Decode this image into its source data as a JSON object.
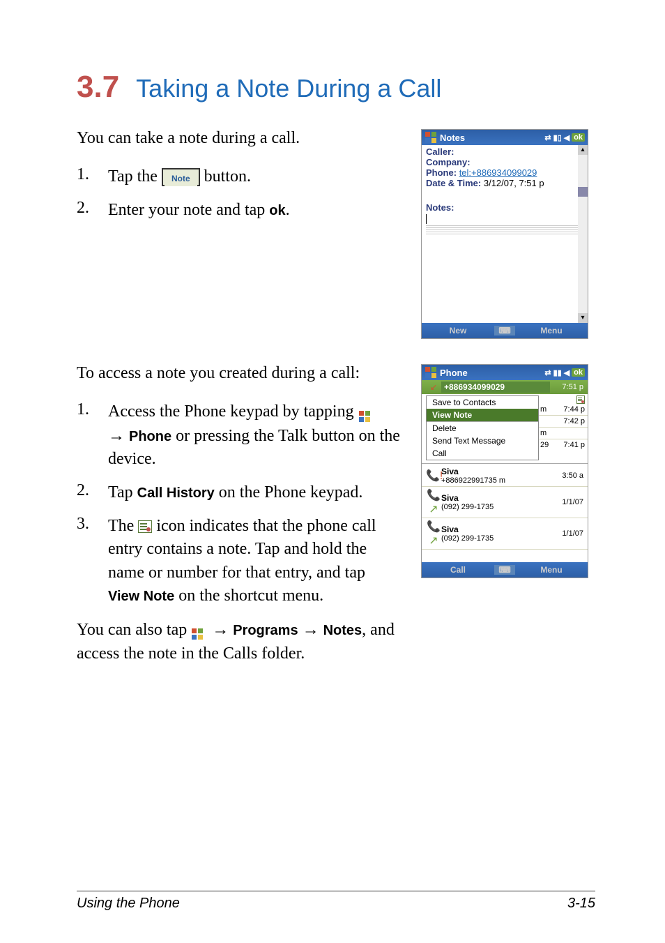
{
  "heading": {
    "number": "3.7",
    "title": "Taking a Note During a Call"
  },
  "intro": "You can take a note during a call.",
  "stepsA": {
    "s1_pre": "Tap the ",
    "s1_btn": "Note",
    "s1_post": " button.",
    "s2": "Enter your note and tap ",
    "s2_ok": "ok",
    "s2_end": "."
  },
  "access_intro": "To access a note you created during a call:",
  "stepsB": {
    "s1a": "Access the Phone keypad by tapping ",
    "s1b": " ",
    "s1c": "Phone",
    "s1d": " or pressing the Talk button on the device.",
    "arrow": "→",
    "s2a": "Tap ",
    "s2b": "Call History",
    "s2c": " on the Phone keypad.",
    "s3a": "The ",
    "s3b": " icon indicates that the phone call entry contains a note. Tap and hold the name or number for that entry, and tap ",
    "s3c": "View Note",
    "s3d": " on the shortcut menu."
  },
  "also": {
    "a": "You can also tap ",
    "arrow1": "→",
    "b": "Programs",
    "arrow2": "→",
    "c": "Notes",
    "d": ", and access the note in the Calls folder."
  },
  "shot1": {
    "title": "Notes",
    "ok": "ok",
    "caller_lbl": "Caller",
    "company_lbl": "Company",
    "phone_lbl": "Phone",
    "phone_link": "tel:+886934099029",
    "dt_lbl": "Date & Time",
    "dt_val": "3/12/07, 7:51 p",
    "notes_lbl": "Notes",
    "menu_left": "New",
    "menu_right": "Menu"
  },
  "shot2": {
    "title": "Phone",
    "ok": "ok",
    "selected_number": "+886934099029",
    "selected_time": "7:51 p",
    "menu": {
      "save": "Save to Contacts",
      "view": "View Note",
      "delete": "Delete",
      "send": "Send Text Message",
      "call": "Call"
    },
    "rows": [
      {
        "m": "m",
        "time": "7:44 p"
      },
      {
        "m": "m",
        "time": "7:42 p"
      },
      {
        "m": "29",
        "time": "7:41 p"
      }
    ],
    "history": [
      {
        "name": "Siva",
        "sub": "+886922991735 m",
        "time": "3:50 a",
        "icon": "missed"
      },
      {
        "name": "Siva",
        "sub": "(092) 299-1735",
        "time": "1/1/07",
        "icon": "out"
      },
      {
        "name": "Siva",
        "sub": "(092) 299-1735",
        "time": "1/1/07",
        "icon": "out"
      }
    ],
    "bottom_left": "Call",
    "bottom_right": "Menu"
  },
  "footer": {
    "left": "Using the Phone",
    "right": "3-15"
  }
}
